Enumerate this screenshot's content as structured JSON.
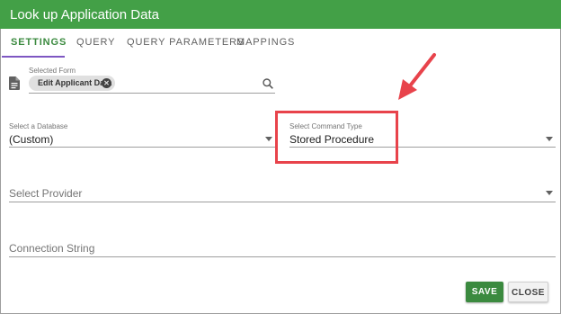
{
  "dialog": {
    "title": "Look up Application Data",
    "header_color": "#43a047"
  },
  "tabs": [
    {
      "label": "SETTINGS",
      "active": true
    },
    {
      "label": "QUERY",
      "active": false
    },
    {
      "label": "QUERY PARAMETERS",
      "active": false
    },
    {
      "label": "MAPPINGS",
      "active": false
    }
  ],
  "selected_form": {
    "label": "Selected Form",
    "chip_label": "Edit Applicant Data",
    "icon": "document-icon",
    "action_icon": "search-icon"
  },
  "database": {
    "label": "Select a Database",
    "value": "(Custom)"
  },
  "command_type": {
    "label": "Select Command Type",
    "value": "Stored Procedure"
  },
  "provider": {
    "placeholder": "Select Provider"
  },
  "connection_string": {
    "placeholder": "Connection String"
  },
  "buttons": {
    "save": "SAVE",
    "close": "CLOSE"
  },
  "annotation": {
    "color": "#e8434b",
    "type": "red arrow and highlight box"
  }
}
